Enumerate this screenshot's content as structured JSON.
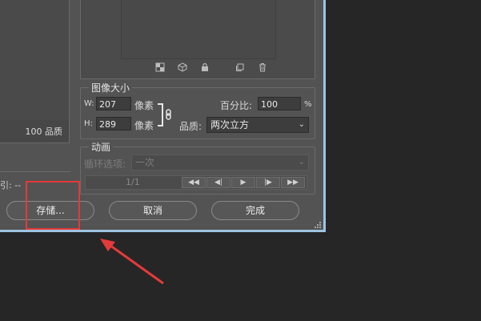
{
  "left_panel": {
    "quality_text": "100 品质",
    "status_text": "引: --"
  },
  "image_size": {
    "title": "图像大小",
    "width_label": "W:",
    "width_value": "207",
    "width_unit": "像素",
    "height_label": "H:",
    "height_value": "289",
    "height_unit": "像素",
    "percent_label": "百分比:",
    "percent_value": "100",
    "percent_unit": "%",
    "quality_label": "品质:",
    "quality_value": "两次立方"
  },
  "animation": {
    "title": "动画",
    "loop_label": "循环选项:",
    "loop_value": "一次",
    "frame_counter": "1/1",
    "controls": [
      "◀◀",
      "◀|",
      "▶",
      "|▶",
      "▶▶"
    ]
  },
  "buttons": {
    "save": "存储...",
    "cancel": "取消",
    "done": "完成"
  },
  "preview_tools": [
    "grid-icon",
    "cube-icon",
    "lock-icon",
    "new-layer-icon",
    "trash-icon"
  ],
  "colors": {
    "dialog_bg": "#535353",
    "page_bg": "#262626",
    "annotation": "#e53a3a",
    "window_edge": "#9fc3e2"
  }
}
